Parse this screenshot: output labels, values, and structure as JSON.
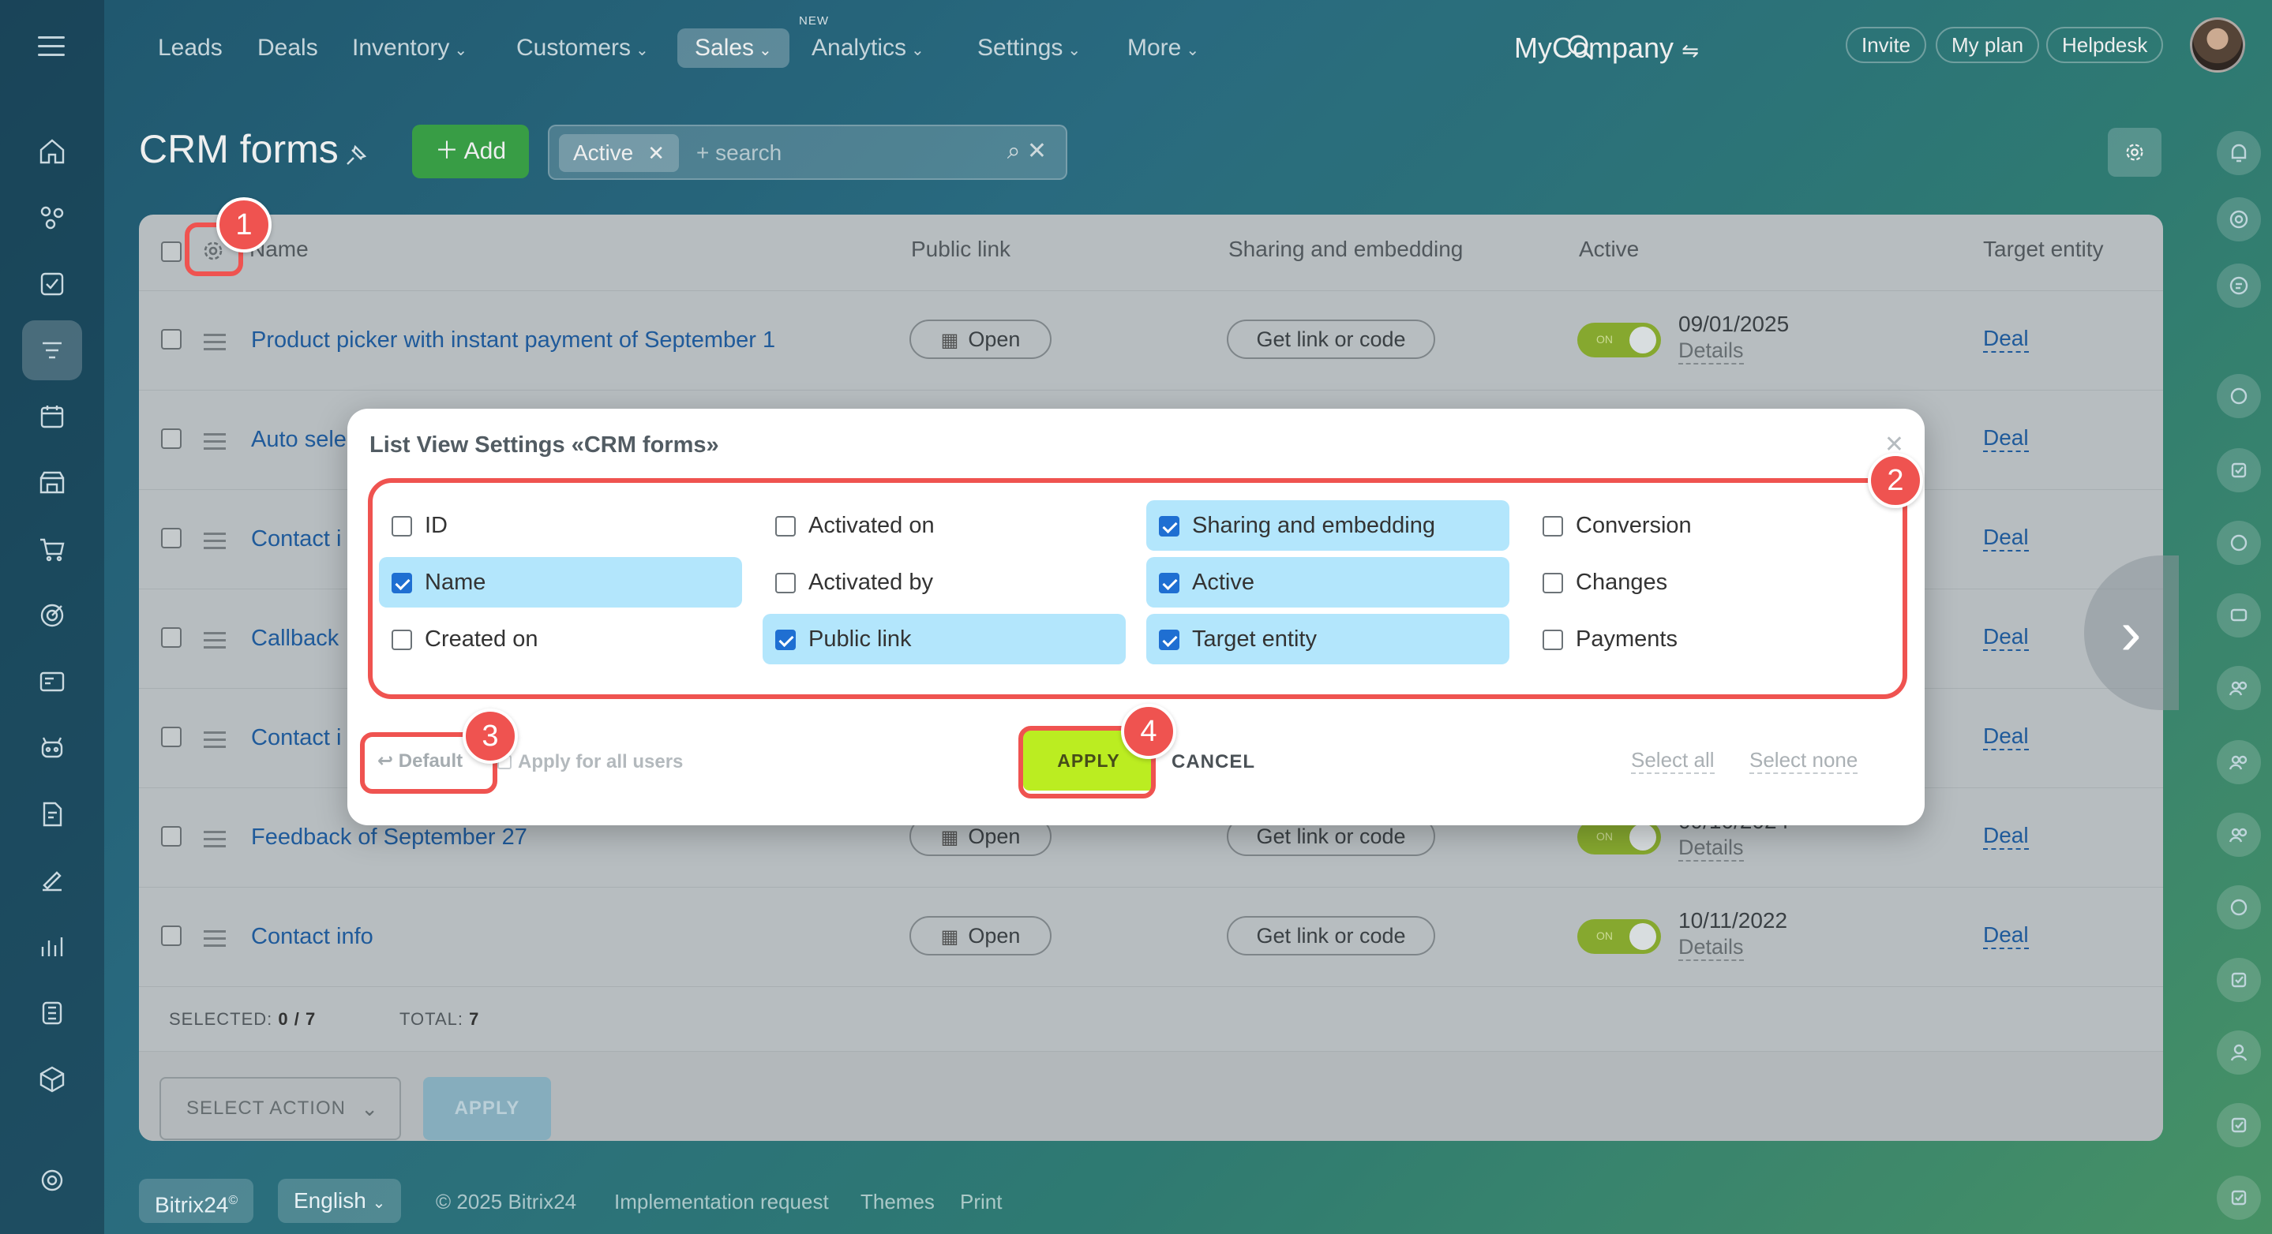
{
  "nav": {
    "items": [
      "Leads",
      "Deals",
      "Inventory",
      "Customers",
      "Sales",
      "Analytics",
      "Settings",
      "More"
    ],
    "new_badge": "NEW",
    "company": "MyCompany",
    "invite": "Invite",
    "my_plan": "My plan",
    "helpdesk": "Helpdesk"
  },
  "page": {
    "title": "CRM forms",
    "add_label": "Add",
    "filter_tag": "Active",
    "search_placeholder": "+ search"
  },
  "table": {
    "headers": [
      "Name",
      "Public link",
      "Sharing and embedding",
      "Active",
      "Target entity"
    ],
    "open_label": "Open",
    "code_label": "Get link or code",
    "toggle_label": "ON",
    "details_label": "Details",
    "rows": [
      {
        "name": "Product picker with instant payment of September 1",
        "date": "09/01/2025",
        "entity": "Deal"
      },
      {
        "name": "Auto sele",
        "entity": "Deal"
      },
      {
        "name": "Contact i",
        "entity": "Deal"
      },
      {
        "name": "Callback",
        "entity": "Deal"
      },
      {
        "name": "Contact i",
        "entity": "Deal"
      },
      {
        "name": "Feedback of September 27",
        "date": "09/10/2024",
        "entity": "Deal"
      },
      {
        "name": "Contact info",
        "date": "10/11/2022",
        "entity": "Deal"
      }
    ],
    "selected_label": "SELECTED:",
    "selected_value": "0 / 7",
    "total_label": "TOTAL:",
    "total_value": "7",
    "select_action": "SELECT ACTION",
    "apply": "APPLY"
  },
  "modal": {
    "title": "List View Settings «CRM forms»",
    "options": [
      {
        "label": "ID",
        "checked": false
      },
      {
        "label": "Name",
        "checked": true
      },
      {
        "label": "Created on",
        "checked": false
      },
      {
        "label": "Activated on",
        "checked": false
      },
      {
        "label": "Activated by",
        "checked": false
      },
      {
        "label": "Public link",
        "checked": true
      },
      {
        "label": "Sharing and embedding",
        "checked": true
      },
      {
        "label": "Active",
        "checked": true
      },
      {
        "label": "Target entity",
        "checked": true
      },
      {
        "label": "Conversion",
        "checked": false
      },
      {
        "label": "Changes",
        "checked": false
      },
      {
        "label": "Payments",
        "checked": false
      }
    ],
    "default_label": "Default",
    "all_users_label": "Apply for all users",
    "apply_label": "APPLY",
    "cancel_label": "CANCEL",
    "select_all": "Select all",
    "select_none": "Select none"
  },
  "badges": [
    "1",
    "2",
    "3",
    "4"
  ],
  "footer": {
    "brand": "Bitrix24",
    "language": "English",
    "copyright": "© 2025 Bitrix24",
    "impl": "Implementation request",
    "themes": "Themes",
    "print": "Print"
  },
  "colors": {
    "accent_green": "#3aa647",
    "apply_lime": "#bbed21",
    "checked_bg": "#b3e6fc",
    "annotation_red": "#ef5350",
    "link_blue": "#1f5ea3"
  }
}
